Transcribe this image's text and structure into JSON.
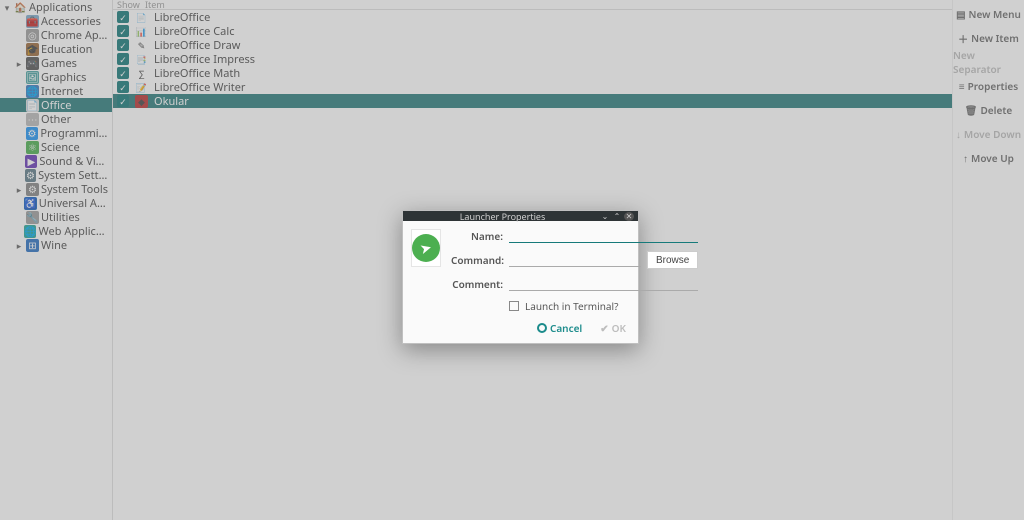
{
  "tree": {
    "root": {
      "label": "Applications",
      "icon": "🏠",
      "expander": "▾"
    },
    "items": [
      {
        "label": "Accessories",
        "icon_bg": "#7fa9c9",
        "icon": "🧰"
      },
      {
        "label": "Chrome Apps",
        "icon_bg": "#9e9e9e",
        "icon": "◎"
      },
      {
        "label": "Education",
        "icon_bg": "#9c6b3c",
        "icon": "🎓"
      },
      {
        "label": "Games",
        "icon_bg": "#555",
        "icon": "🎮",
        "expander": "▸"
      },
      {
        "label": "Graphics",
        "icon_bg": "#4aa3a3",
        "icon": "🖼"
      },
      {
        "label": "Internet",
        "icon_bg": "#3b7bbf",
        "icon": "🌐"
      },
      {
        "label": "Office",
        "icon_bg": "#e0e0e0",
        "icon": "📄",
        "selected": true
      },
      {
        "label": "Other",
        "icon_bg": "#bbb",
        "icon": "⋯"
      },
      {
        "label": "Programming",
        "icon_bg": "#2196f3",
        "icon": "⚙"
      },
      {
        "label": "Science",
        "icon_bg": "#4caf50",
        "icon": "⚛"
      },
      {
        "label": "Sound & Video",
        "icon_bg": "#673ab7",
        "icon": "▶"
      },
      {
        "label": "System Settings",
        "icon_bg": "#607d8b",
        "icon": "⚙"
      },
      {
        "label": "System Tools",
        "icon_bg": "#888",
        "icon": "⚙",
        "expander": "▸"
      },
      {
        "label": "Universal Access",
        "icon_bg": "#1565c0",
        "icon": "♿"
      },
      {
        "label": "Utilities",
        "icon_bg": "#9e9e9e",
        "icon": "🔧"
      },
      {
        "label": "Web Applications",
        "icon_bg": "#26a69a",
        "icon": "🌐"
      },
      {
        "label": "Wine",
        "icon_bg": "#2a70c2",
        "icon": "⊞",
        "expander": "▸"
      }
    ]
  },
  "list": {
    "headers": {
      "show": "Show",
      "item": "Item"
    },
    "items": [
      {
        "label": "LibreOffice",
        "checked": true,
        "icon_bg": "#fff",
        "icon": "📄"
      },
      {
        "label": "LibreOffice Calc",
        "checked": true,
        "icon_bg": "#fff",
        "icon": "📊"
      },
      {
        "label": "LibreOffice Draw",
        "checked": true,
        "icon_bg": "#fff",
        "icon": "✎"
      },
      {
        "label": "LibreOffice Impress",
        "checked": true,
        "icon_bg": "#fff",
        "icon": "📑"
      },
      {
        "label": "LibreOffice Math",
        "checked": true,
        "icon_bg": "#fff",
        "icon": "∑"
      },
      {
        "label": "LibreOffice Writer",
        "checked": true,
        "icon_bg": "#fff",
        "icon": "📝"
      },
      {
        "label": "Okular",
        "checked": true,
        "icon_bg": "#b33",
        "icon": "◆",
        "selected": true
      }
    ]
  },
  "right": [
    {
      "label": "New Menu",
      "icon": "▤",
      "disabled": false
    },
    {
      "label": "New Item",
      "icon": "＋",
      "disabled": false
    },
    {
      "label": "New Separator",
      "icon": "",
      "disabled": true
    },
    {
      "label": "Properties",
      "icon": "≡",
      "disabled": false
    },
    {
      "label": "Delete",
      "icon": "🗑",
      "disabled": false
    },
    {
      "label": "Move Down",
      "icon": "↓",
      "disabled": true
    },
    {
      "label": "Move Up",
      "icon": "↑",
      "disabled": false
    }
  ],
  "dialog": {
    "title": "Launcher Properties",
    "fields": {
      "name_label": "Name:",
      "command_label": "Command:",
      "comment_label": "Comment:",
      "browse": "Browse",
      "terminal": "Launch in Terminal?"
    },
    "actions": {
      "cancel": "Cancel",
      "ok": "OK"
    }
  }
}
